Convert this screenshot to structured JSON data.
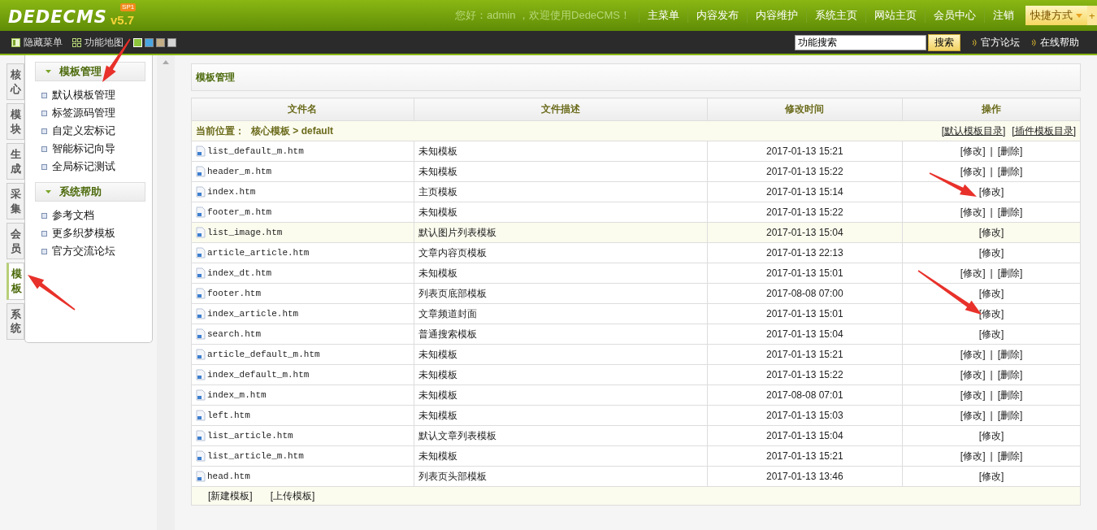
{
  "header": {
    "logo": {
      "name": "DEDECMS",
      "version": "v5.7",
      "badge": "SP1"
    },
    "greeting": "您好：admin ，欢迎使用DedeCMS！",
    "nav": [
      "主菜单",
      "内容发布",
      "内容维护",
      "系统主页",
      "网站主页",
      "会员中心",
      "注销"
    ],
    "quick": {
      "label": "快捷方式",
      "extra": "+"
    }
  },
  "toolbar": {
    "items": [
      {
        "kind": "hide",
        "label": "隐藏菜单"
      },
      {
        "kind": "map",
        "label": "功能地图"
      }
    ],
    "swatches": [
      {
        "color": "#8cc43c",
        "selected": true
      },
      {
        "color": "#4aa6e0",
        "selected": false
      },
      {
        "color": "#c4ae86",
        "selected": false
      },
      {
        "color": "#d4d4d4",
        "selected": false
      }
    ],
    "search": {
      "value": "功能搜索",
      "button": "搜索"
    },
    "links": [
      "官方论坛",
      "在线帮助"
    ]
  },
  "side_tabs": [
    {
      "label": "核心",
      "selected": false
    },
    {
      "label": "模块",
      "selected": false
    },
    {
      "label": "生成",
      "selected": false
    },
    {
      "label": "采集",
      "selected": false
    },
    {
      "label": "会员",
      "selected": false
    },
    {
      "label": "模板",
      "selected": true
    },
    {
      "label": "系统",
      "selected": false
    }
  ],
  "sidebar": {
    "groups": [
      {
        "title": "模板管理",
        "items": [
          "默认模板管理",
          "标签源码管理",
          "自定义宏标记",
          "智能标记向导",
          "全局标记测试"
        ]
      },
      {
        "title": "系统帮助",
        "items": [
          "参考文档",
          "更多织梦模板",
          "官方交流论坛"
        ]
      }
    ]
  },
  "main": {
    "title": "模板管理",
    "table": {
      "columns": [
        "文件名",
        "文件描述",
        "修改时间",
        "操作"
      ],
      "location": {
        "label": "当前位置：",
        "path": "核心模板 > default",
        "links": [
          "[默认模板目录]",
          "[插件模板目录]"
        ]
      },
      "separator": "|",
      "rows": [
        {
          "file": "list_default_m.htm",
          "desc": "未知模板",
          "time": "2017-01-13 15:21",
          "actions": [
            "[修改]",
            "[删除]"
          ],
          "highlighted": false
        },
        {
          "file": "header_m.htm",
          "desc": "未知模板",
          "time": "2017-01-13 15:22",
          "actions": [
            "[修改]",
            "[删除]"
          ],
          "highlighted": false
        },
        {
          "file": "index.htm",
          "desc": "主页模板",
          "time": "2017-01-13 15:14",
          "actions": [
            "[修改]"
          ],
          "highlighted": false
        },
        {
          "file": "footer_m.htm",
          "desc": "未知模板",
          "time": "2017-01-13 15:22",
          "actions": [
            "[修改]",
            "[删除]"
          ],
          "highlighted": false
        },
        {
          "file": "list_image.htm",
          "desc": "默认图片列表模板",
          "time": "2017-01-13 15:04",
          "actions": [
            "[修改]"
          ],
          "highlighted": true
        },
        {
          "file": "article_article.htm",
          "desc": "文章内容页模板",
          "time": "2017-01-13 22:13",
          "actions": [
            "[修改]"
          ],
          "highlighted": false
        },
        {
          "file": "index_dt.htm",
          "desc": "未知模板",
          "time": "2017-01-13 15:01",
          "actions": [
            "[修改]",
            "[删除]"
          ],
          "highlighted": false
        },
        {
          "file": "footer.htm",
          "desc": "列表页底部模板",
          "time": "2017-08-08 07:00",
          "actions": [
            "[修改]"
          ],
          "highlighted": false
        },
        {
          "file": "index_article.htm",
          "desc": "文章频道封面",
          "time": "2017-01-13 15:01",
          "actions": [
            "[修改]"
          ],
          "highlighted": false
        },
        {
          "file": "search.htm",
          "desc": "普通搜索模板",
          "time": "2017-01-13 15:04",
          "actions": [
            "[修改]"
          ],
          "highlighted": false
        },
        {
          "file": "article_default_m.htm",
          "desc": "未知模板",
          "time": "2017-01-13 15:21",
          "actions": [
            "[修改]",
            "[删除]"
          ],
          "highlighted": false
        },
        {
          "file": "index_default_m.htm",
          "desc": "未知模板",
          "time": "2017-01-13 15:22",
          "actions": [
            "[修改]",
            "[删除]"
          ],
          "highlighted": false
        },
        {
          "file": "index_m.htm",
          "desc": "未知模板",
          "time": "2017-08-08 07:01",
          "actions": [
            "[修改]",
            "[删除]"
          ],
          "highlighted": false
        },
        {
          "file": "left.htm",
          "desc": "未知模板",
          "time": "2017-01-13 15:03",
          "actions": [
            "[修改]",
            "[删除]"
          ],
          "highlighted": false
        },
        {
          "file": "list_article.htm",
          "desc": "默认文章列表模板",
          "time": "2017-01-13 15:04",
          "actions": [
            "[修改]"
          ],
          "highlighted": false
        },
        {
          "file": "list_article_m.htm",
          "desc": "未知模板",
          "time": "2017-01-13 15:21",
          "actions": [
            "[修改]",
            "[删除]"
          ],
          "highlighted": false
        },
        {
          "file": "head.htm",
          "desc": "列表页头部模板",
          "time": "2017-01-13 13:46",
          "actions": [
            "[修改]"
          ],
          "highlighted": false
        }
      ],
      "footer": [
        "[新建模板]",
        "[上传模板]"
      ]
    }
  }
}
